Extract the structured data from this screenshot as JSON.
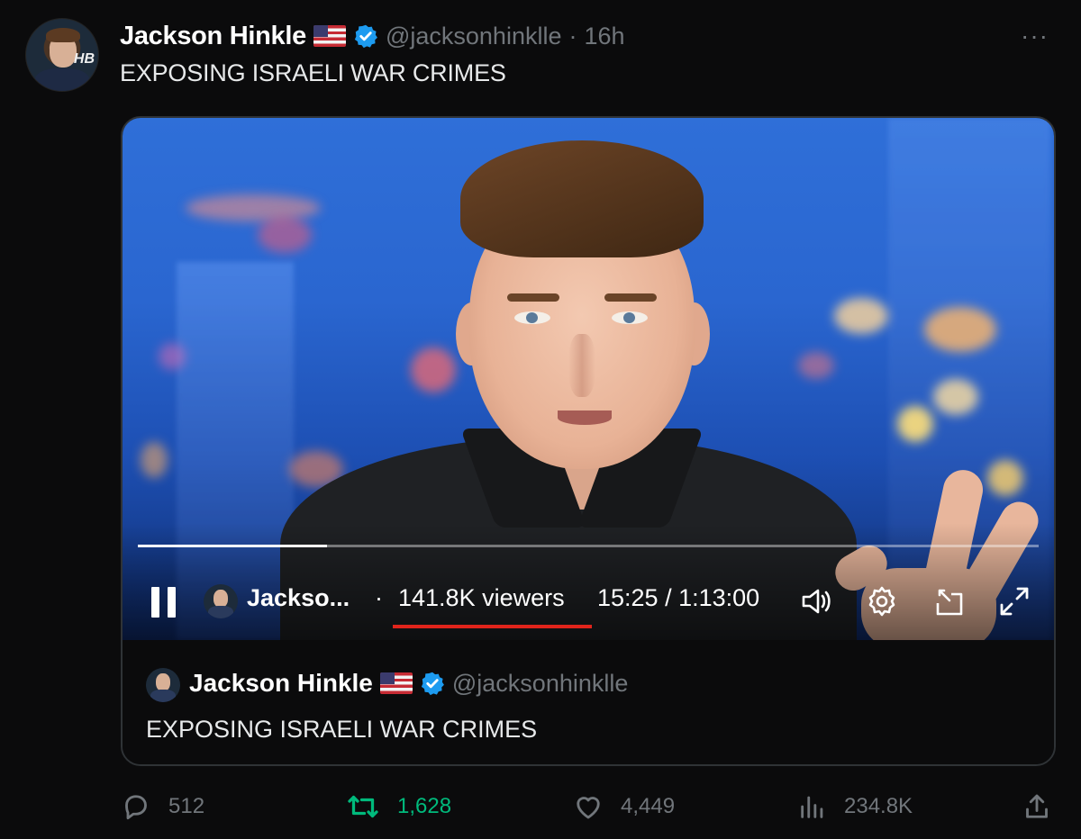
{
  "tweet": {
    "author_name": "Jackson Hinkle",
    "handle": "@jacksonhinklle",
    "separator": "·",
    "time": "16h",
    "more_label": "···",
    "text": "EXPOSING ISRAELI WAR CRIMES",
    "avatar_mark": "HB"
  },
  "video": {
    "channel_name": "Jackso...",
    "separator": "·",
    "viewers": "141.8K viewers",
    "time_display": "15:25 / 1:13:00",
    "progress_fraction": 0.21
  },
  "quoted": {
    "author_name": "Jackson Hinkle",
    "handle": "@jacksonhinklle",
    "text": "EXPOSING ISRAELI WAR CRIMES"
  },
  "actions": {
    "replies": "512",
    "reposts": "1,628",
    "likes": "4,449",
    "views": "234.8K"
  },
  "icons": {
    "verified": "verified-badge-icon",
    "flag": "us-flag-icon",
    "pause": "pause-icon",
    "volume": "volume-icon",
    "settings": "gear-icon",
    "pip": "picture-in-picture-icon",
    "fullscreen": "fullscreen-icon",
    "reply": "reply-icon",
    "repost": "repost-icon",
    "like": "heart-icon",
    "views": "views-icon",
    "share": "share-icon"
  },
  "colors": {
    "background": "#0b0b0c",
    "muted": "#71767b",
    "verified_blue": "#1d9bf0",
    "repost_green": "#00ba7c",
    "highlight_red": "#e0241b"
  }
}
